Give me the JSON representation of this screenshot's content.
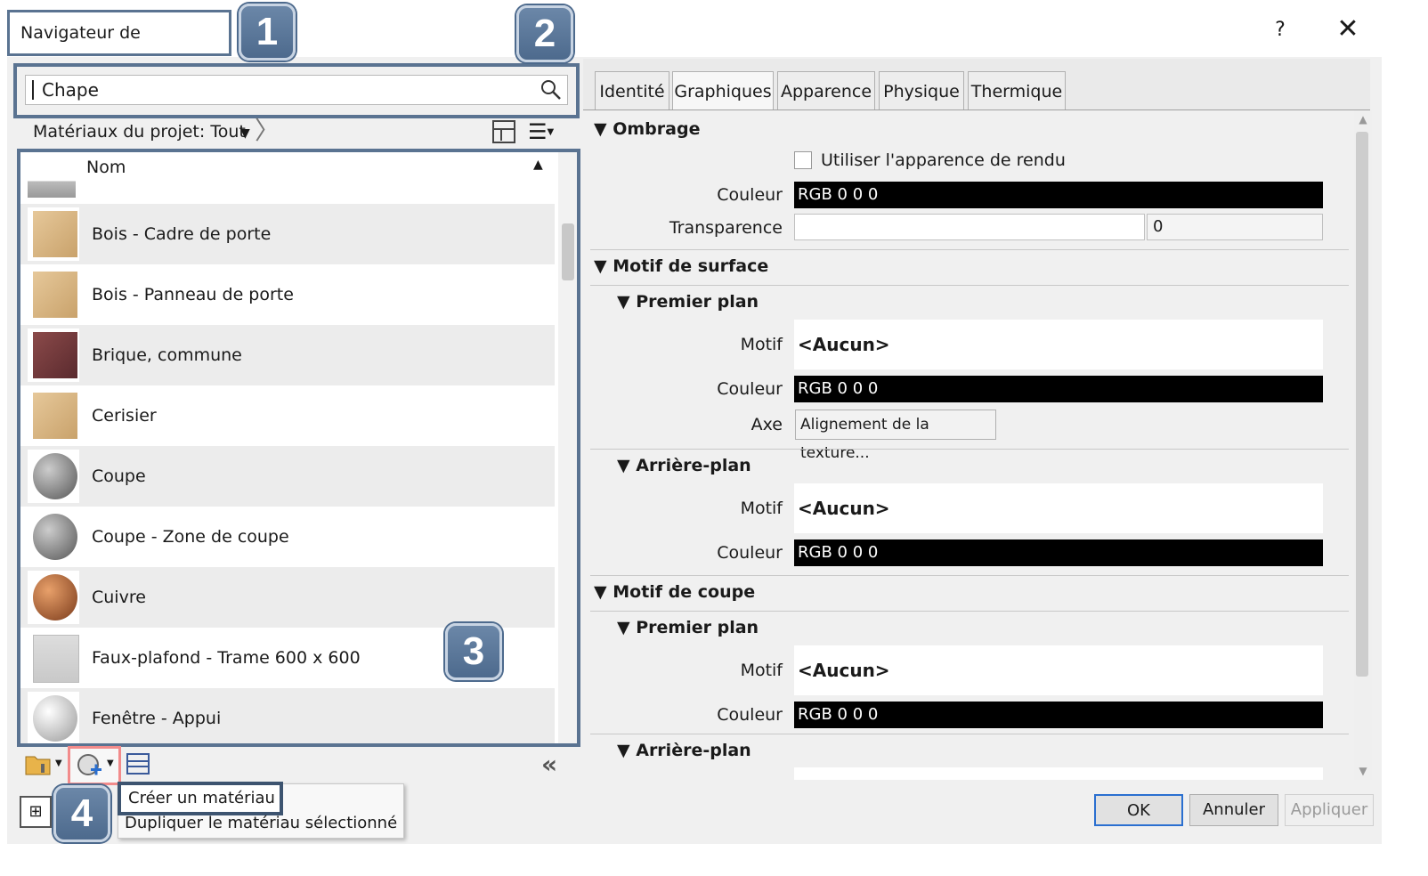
{
  "window": {
    "title": "Navigateur de matériaux",
    "help": "?",
    "close": "✕"
  },
  "callouts": [
    "1",
    "2",
    "3",
    "4"
  ],
  "search": {
    "value": "Chape"
  },
  "filter": {
    "label": "Matériaux du projet: Tout"
  },
  "list": {
    "header": "Nom",
    "items": [
      {
        "label": "Bois - Cadre de porte",
        "icon": "wood-swatch-icon"
      },
      {
        "label": "Bois - Panneau de porte",
        "icon": "wood-swatch-icon"
      },
      {
        "label": "Brique, commune",
        "icon": "brick-swatch-icon"
      },
      {
        "label": "Cerisier",
        "icon": "wood-swatch-icon"
      },
      {
        "label": "Coupe",
        "icon": "grey-sphere-icon"
      },
      {
        "label": "Coupe - Zone de coupe",
        "icon": "grey-sphere-icon"
      },
      {
        "label": "Cuivre",
        "icon": "copper-sphere-icon"
      },
      {
        "label": "Faux-plafond - Trame 600 x 600",
        "icon": "ceiling-tile-icon"
      },
      {
        "label": "Fenêtre - Appui",
        "icon": "white-sphere-icon"
      }
    ]
  },
  "menu": {
    "create": "Créer un matériau",
    "duplicate": "Dupliquer le matériau sélectionné"
  },
  "tabs": [
    "Identité",
    "Graphiques",
    "Apparence",
    "Physique",
    "Thermique"
  ],
  "active_tab": "Graphiques",
  "graphics": {
    "shading": {
      "title": "Ombrage",
      "use_render_label": "Utiliser l'apparence de rendu",
      "color_label": "Couleur",
      "color_value": "RGB 0 0 0",
      "transparency_label": "Transparence",
      "transparency_value": "0"
    },
    "surface": {
      "title": "Motif de surface",
      "foreground": {
        "title": "Premier plan",
        "pattern_label": "Motif",
        "pattern_value": "<Aucun>",
        "color_label": "Couleur",
        "color_value": "RGB 0 0 0",
        "axis_label": "Axe",
        "axis_button": "Alignement de la texture..."
      },
      "background": {
        "title": "Arrière-plan",
        "pattern_label": "Motif",
        "pattern_value": "<Aucun>",
        "color_label": "Couleur",
        "color_value": "RGB 0 0 0"
      }
    },
    "cut": {
      "title": "Motif de coupe",
      "foreground": {
        "title": "Premier plan",
        "pattern_label": "Motif",
        "pattern_value": "<Aucun>",
        "color_label": "Couleur",
        "color_value": "RGB 0 0 0"
      },
      "background": {
        "title": "Arrière-plan"
      }
    }
  },
  "buttons": {
    "ok": "OK",
    "cancel": "Annuler",
    "apply": "Appliquer"
  },
  "colors": {
    "callout_frame": "#5a7391",
    "highlight": "#f28b8b"
  }
}
